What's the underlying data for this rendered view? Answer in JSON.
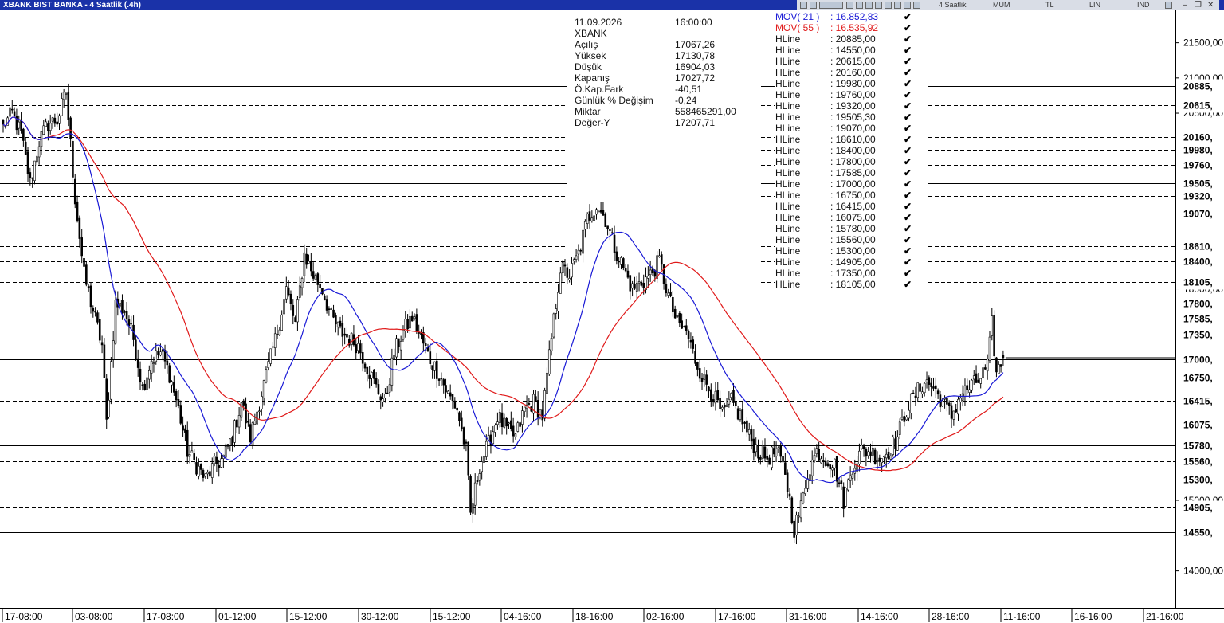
{
  "window": {
    "title": "XBANK BIST BANKA - 4 Saatlik (.4h)",
    "toolbar": {
      "period": "4 Saatlik",
      "chart_style": "MUM",
      "currency": "TL",
      "scale": "LIN",
      "mode": "IND"
    }
  },
  "info_panel": {
    "date": "11.09.2026",
    "time": "16:00:00",
    "symbol": "XBANK",
    "rows": [
      {
        "label": "Açılış",
        "value": "17067,26"
      },
      {
        "label": "Yüksek",
        "value": "17130,78"
      },
      {
        "label": "Düşük",
        "value": "16904,03"
      },
      {
        "label": "Kapanış",
        "value": "17027,72"
      },
      {
        "label": "Ö.Kap.Fark",
        "value": "-40,51"
      },
      {
        "label": "Günlük % Değişim",
        "value": "-0,24"
      },
      {
        "label": "Miktar",
        "value": "558465291,00"
      },
      {
        "label": "Değer-Y",
        "value": "17207,71"
      }
    ]
  },
  "indicators": [
    {
      "label": "MOV( 21 )",
      "value": ": 16.852,83",
      "color": "#1a1ad6"
    },
    {
      "label": "MOV( 55 )",
      "value": ": 16.535,92",
      "color": "#e01a1a"
    },
    {
      "label": "HLine",
      "value": ": 20885,00"
    },
    {
      "label": "HLine",
      "value": ": 14550,00"
    },
    {
      "label": "HLine",
      "value": ": 20615,00"
    },
    {
      "label": "HLine",
      "value": ": 20160,00"
    },
    {
      "label": "HLine",
      "value": ": 19980,00"
    },
    {
      "label": "HLine",
      "value": ": 19760,00"
    },
    {
      "label": "HLine",
      "value": ": 19320,00"
    },
    {
      "label": "HLine",
      "value": ": 19505,30"
    },
    {
      "label": "HLine",
      "value": ": 19070,00"
    },
    {
      "label": "HLine",
      "value": ": 18610,00"
    },
    {
      "label": "HLine",
      "value": ": 18400,00"
    },
    {
      "label": "HLine",
      "value": ": 17800,00"
    },
    {
      "label": "HLine",
      "value": ": 17585,00"
    },
    {
      "label": "HLine",
      "value": ": 17000,00"
    },
    {
      "label": "HLine",
      "value": ": 16750,00"
    },
    {
      "label": "HLine",
      "value": ": 16415,00"
    },
    {
      "label": "HLine",
      "value": ": 16075,00"
    },
    {
      "label": "HLine",
      "value": ": 15780,00"
    },
    {
      "label": "HLine",
      "value": ": 15560,00"
    },
    {
      "label": "HLine",
      "value": ": 15300,00"
    },
    {
      "label": "HLine",
      "value": ": 14905,00"
    },
    {
      "label": "HLine",
      "value": ": 17350,00"
    },
    {
      "label": "HLine",
      "value": ": 18105,00"
    }
  ],
  "chart_data": {
    "type": "candlestick",
    "symbol": "XBANK",
    "ylim": [
      13800,
      21800
    ],
    "y_ticks": [
      {
        "value": 21500,
        "label": "21500,00"
      },
      {
        "value": 21000,
        "label": "21000,00"
      },
      {
        "value": 20500,
        "label": "20500,00"
      },
      {
        "value": 18000,
        "label": "18000,00"
      },
      {
        "value": 15000,
        "label": "15000,00"
      },
      {
        "value": 14000,
        "label": "14000,00"
      }
    ],
    "x_ticks": [
      "17-08:00",
      "03-08:00",
      "17-08:00",
      "01-12:00",
      "15-12:00",
      "30-12:00",
      "15-12:00",
      "04-16:00",
      "18-16:00",
      "02-16:00",
      "17-16:00",
      "31-16:00",
      "14-16:00",
      "28-16:00",
      "11-16:00",
      "16-16:00",
      "21-16:00"
    ],
    "hlines": [
      {
        "value": 20885,
        "label": "20885,",
        "style": "solid"
      },
      {
        "value": 20615,
        "label": "20615,",
        "style": "dashed"
      },
      {
        "value": 20160,
        "label": "20160,",
        "style": "dashed"
      },
      {
        "value": 19980,
        "label": "19980,",
        "style": "dashed"
      },
      {
        "value": 19760,
        "label": "19760,",
        "style": "dashed"
      },
      {
        "value": 19505,
        "label": "19505,",
        "style": "solid"
      },
      {
        "value": 19320,
        "label": "19320,",
        "style": "dashed"
      },
      {
        "value": 19070,
        "label": "19070,",
        "style": "dashed"
      },
      {
        "value": 18610,
        "label": "18610,",
        "style": "dashed"
      },
      {
        "value": 18400,
        "label": "18400,",
        "style": "dashed"
      },
      {
        "value": 18105,
        "label": "18105,",
        "style": "dashed"
      },
      {
        "value": 17800,
        "label": "17800,",
        "style": "solid"
      },
      {
        "value": 17585,
        "label": "17585,",
        "style": "dashed"
      },
      {
        "value": 17350,
        "label": "17350,",
        "style": "dashed"
      },
      {
        "value": 17000,
        "label": "17000,",
        "style": "solid"
      },
      {
        "value": 16750,
        "label": "16750,",
        "style": "solid"
      },
      {
        "value": 16415,
        "label": "16415,",
        "style": "dashed"
      },
      {
        "value": 16075,
        "label": "16075,",
        "style": "dashed"
      },
      {
        "value": 15780,
        "label": "15780,",
        "style": "solid"
      },
      {
        "value": 15560,
        "label": "15560,",
        "style": "dashed"
      },
      {
        "value": 15300,
        "label": "15300,",
        "style": "dashed"
      },
      {
        "value": 14905,
        "label": "14905,",
        "style": "dashed"
      },
      {
        "value": 14550,
        "label": "14550,",
        "style": "solid"
      }
    ],
    "close_anchors": [
      {
        "x": 0,
        "close": 20300
      },
      {
        "x": 4,
        "close": 20500
      },
      {
        "x": 8,
        "close": 20200
      },
      {
        "x": 12,
        "close": 19500
      },
      {
        "x": 16,
        "close": 20100
      },
      {
        "x": 20,
        "close": 20350
      },
      {
        "x": 24,
        "close": 20400
      },
      {
        "x": 28,
        "close": 20800
      },
      {
        "x": 32,
        "close": 19300
      },
      {
        "x": 36,
        "close": 18200
      },
      {
        "x": 40,
        "close": 17700
      },
      {
        "x": 44,
        "close": 17200
      },
      {
        "x": 46,
        "close": 16100
      },
      {
        "x": 50,
        "close": 17800
      },
      {
        "x": 54,
        "close": 17700
      },
      {
        "x": 58,
        "close": 17300
      },
      {
        "x": 62,
        "close": 16600
      },
      {
        "x": 66,
        "close": 17000
      },
      {
        "x": 70,
        "close": 17100
      },
      {
        "x": 74,
        "close": 16800
      },
      {
        "x": 78,
        "close": 16300
      },
      {
        "x": 82,
        "close": 15700
      },
      {
        "x": 86,
        "close": 15500
      },
      {
        "x": 90,
        "close": 15300
      },
      {
        "x": 94,
        "close": 15500
      },
      {
        "x": 98,
        "close": 15600
      },
      {
        "x": 102,
        "close": 15900
      },
      {
        "x": 106,
        "close": 16400
      },
      {
        "x": 110,
        "close": 15900
      },
      {
        "x": 114,
        "close": 16400
      },
      {
        "x": 118,
        "close": 16900
      },
      {
        "x": 122,
        "close": 17400
      },
      {
        "x": 126,
        "close": 18000
      },
      {
        "x": 130,
        "close": 17500
      },
      {
        "x": 134,
        "close": 18500
      },
      {
        "x": 138,
        "close": 18200
      },
      {
        "x": 142,
        "close": 18000
      },
      {
        "x": 146,
        "close": 17600
      },
      {
        "x": 150,
        "close": 17400
      },
      {
        "x": 154,
        "close": 17300
      },
      {
        "x": 158,
        "close": 17200
      },
      {
        "x": 162,
        "close": 16900
      },
      {
        "x": 166,
        "close": 16600
      },
      {
        "x": 170,
        "close": 16400
      },
      {
        "x": 174,
        "close": 17100
      },
      {
        "x": 178,
        "close": 17400
      },
      {
        "x": 182,
        "close": 17600
      },
      {
        "x": 186,
        "close": 17300
      },
      {
        "x": 190,
        "close": 17000
      },
      {
        "x": 194,
        "close": 16800
      },
      {
        "x": 198,
        "close": 16500
      },
      {
        "x": 202,
        "close": 16300
      },
      {
        "x": 206,
        "close": 15700
      },
      {
        "x": 208,
        "close": 14800
      },
      {
        "x": 212,
        "close": 15500
      },
      {
        "x": 216,
        "close": 15800
      },
      {
        "x": 220,
        "close": 16200
      },
      {
        "x": 224,
        "close": 16000
      },
      {
        "x": 228,
        "close": 15900
      },
      {
        "x": 232,
        "close": 16300
      },
      {
        "x": 236,
        "close": 16400
      },
      {
        "x": 240,
        "close": 16200
      },
      {
        "x": 244,
        "close": 17300
      },
      {
        "x": 248,
        "close": 18300
      },
      {
        "x": 252,
        "close": 18200
      },
      {
        "x": 256,
        "close": 18500
      },
      {
        "x": 260,
        "close": 19000
      },
      {
        "x": 264,
        "close": 19200
      },
      {
        "x": 268,
        "close": 19000
      },
      {
        "x": 272,
        "close": 18600
      },
      {
        "x": 276,
        "close": 18300
      },
      {
        "x": 280,
        "close": 18000
      },
      {
        "x": 284,
        "close": 18100
      },
      {
        "x": 288,
        "close": 18200
      },
      {
        "x": 292,
        "close": 18400
      },
      {
        "x": 296,
        "close": 17900
      },
      {
        "x": 300,
        "close": 17500
      },
      {
        "x": 304,
        "close": 17400
      },
      {
        "x": 308,
        "close": 17000
      },
      {
        "x": 312,
        "close": 16700
      },
      {
        "x": 316,
        "close": 16500
      },
      {
        "x": 320,
        "close": 16200
      },
      {
        "x": 324,
        "close": 16400
      },
      {
        "x": 328,
        "close": 16200
      },
      {
        "x": 332,
        "close": 15900
      },
      {
        "x": 336,
        "close": 15700
      },
      {
        "x": 340,
        "close": 15600
      },
      {
        "x": 344,
        "close": 15700
      },
      {
        "x": 348,
        "close": 15400
      },
      {
        "x": 352,
        "close": 14600
      },
      {
        "x": 355,
        "close": 14900
      },
      {
        "x": 358,
        "close": 15400
      },
      {
        "x": 362,
        "close": 15700
      },
      {
        "x": 366,
        "close": 15600
      },
      {
        "x": 370,
        "close": 15500
      },
      {
        "x": 374,
        "close": 15000
      },
      {
        "x": 378,
        "close": 15500
      },
      {
        "x": 382,
        "close": 15700
      },
      {
        "x": 386,
        "close": 15700
      },
      {
        "x": 390,
        "close": 15600
      },
      {
        "x": 394,
        "close": 15700
      },
      {
        "x": 398,
        "close": 15900
      },
      {
        "x": 402,
        "close": 16300
      },
      {
        "x": 406,
        "close": 16500
      },
      {
        "x": 410,
        "close": 16700
      },
      {
        "x": 414,
        "close": 16600
      },
      {
        "x": 418,
        "close": 16400
      },
      {
        "x": 422,
        "close": 16200
      },
      {
        "x": 426,
        "close": 16500
      },
      {
        "x": 430,
        "close": 16600
      },
      {
        "x": 434,
        "close": 16700
      },
      {
        "x": 438,
        "close": 16900
      },
      {
        "x": 440,
        "close": 17500
      },
      {
        "x": 442,
        "close": 16800
      },
      {
        "x": 445,
        "close": 17030
      }
    ],
    "last_candle": {
      "open": 17067.26,
      "high": 17130.78,
      "low": 16904.03,
      "close": 17027.72
    },
    "series": [
      {
        "name": "MOV( 21 )",
        "color": "#1a1ad6",
        "last": 16852.83
      },
      {
        "name": "MOV( 55 )",
        "color": "#e01a1a",
        "last": 16535.92
      }
    ]
  }
}
